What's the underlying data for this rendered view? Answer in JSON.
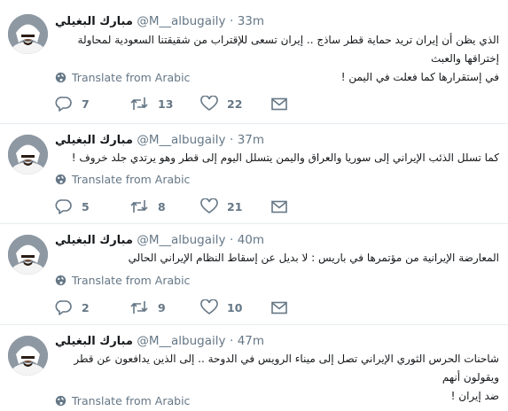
{
  "colors": {
    "text_primary": "#14171a",
    "text_secondary": "#657786",
    "divider": "#e6ecf0"
  },
  "tweets": [
    {
      "name": "مبارك البغيلي",
      "handle": "@M__albugaily",
      "separator": "·",
      "time": "33m",
      "lines": [
        "الذي يظن أن إيران تريد حماية قطر ساذج .. إيران تسعى للإقتراب من شقيقتنا السعودية لمحاولة إختراقها والعبث",
        "في إستقرارها كما فعلت في اليمن !"
      ],
      "translate_label": "Translate from Arabic",
      "replies": "7",
      "retweets": "13",
      "likes": "22"
    },
    {
      "name": "مبارك البغيلي",
      "handle": "@M__albugaily",
      "separator": "·",
      "time": "37m",
      "lines": [
        "كما تسلل الذئب الإيراني إلى سوريا والعراق واليمن يتسلل اليوم إلى قطر وهو يرتدي جلد خروف !"
      ],
      "translate_label": "Translate from Arabic",
      "replies": "5",
      "retweets": "8",
      "likes": "21"
    },
    {
      "name": "مبارك البغيلي",
      "handle": "@M__albugaily",
      "separator": "·",
      "time": "40m",
      "lines": [
        "المعارضة الإيرانية من مؤتمرها في باريس : لا بديل عن إسقاط النظام الإيراني الحالي"
      ],
      "translate_label": "Translate from Arabic",
      "replies": "2",
      "retweets": "9",
      "likes": "10"
    },
    {
      "name": "مبارك البغيلي",
      "handle": "@M__albugaily",
      "separator": "·",
      "time": "47m",
      "lines": [
        "شاحنات الحرس الثوري الإيراني تصل إلى ميناء الرويس في الدوحة .. إلى الذين يدافعون عن قطر ويقولون أنهم",
        "ضد إيران !"
      ],
      "translate_label": "Translate from Arabic"
    }
  ]
}
